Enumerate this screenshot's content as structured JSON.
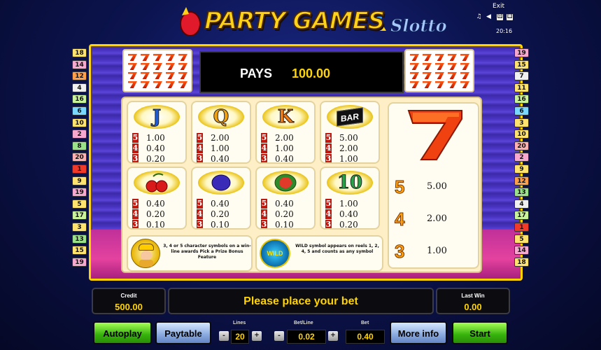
{
  "logo": {
    "title": "PARTY GAMES",
    "subtitle": "Slotto"
  },
  "system": {
    "exit_label": "Exit",
    "time": "20:16"
  },
  "paylines_left": [
    {
      "n": "18",
      "color": "#ffe36e"
    },
    {
      "n": "14",
      "color": "#f6a8cf"
    },
    {
      "n": "12",
      "color": "#ff9f4a"
    },
    {
      "n": "4",
      "color": "#f0f0f0"
    },
    {
      "n": "16",
      "color": "#c9f39a"
    },
    {
      "n": "6",
      "color": "#7ad7ff"
    },
    {
      "n": "10",
      "color": "#ffe36e"
    },
    {
      "n": "2",
      "color": "#f6a8cf"
    },
    {
      "n": "8",
      "color": "#9be18a"
    },
    {
      "n": "20",
      "color": "#ffb0b0"
    },
    {
      "n": "1",
      "color": "#f03a2a"
    },
    {
      "n": "9",
      "color": "#ffe36e"
    },
    {
      "n": "19",
      "color": "#f6a8cf"
    },
    {
      "n": "5",
      "color": "#ffe36e"
    },
    {
      "n": "17",
      "color": "#c9f39a"
    },
    {
      "n": "3",
      "color": "#ffe36e"
    },
    {
      "n": "13",
      "color": "#9be18a"
    },
    {
      "n": "15",
      "color": "#ffe36e"
    },
    {
      "n": "19",
      "color": "#f6a8cf"
    }
  ],
  "paylines_right": [
    {
      "n": "19",
      "color": "#f6a8cf"
    },
    {
      "n": "15",
      "color": "#ffe36e"
    },
    {
      "n": "7",
      "color": "#f0f0f0"
    },
    {
      "n": "11",
      "color": "#ffe36e"
    },
    {
      "n": "16",
      "color": "#c9f39a"
    },
    {
      "n": "6",
      "color": "#7ad7ff"
    },
    {
      "n": "3",
      "color": "#ffe36e"
    },
    {
      "n": "10",
      "color": "#ffe36e"
    },
    {
      "n": "20",
      "color": "#ffb0b0"
    },
    {
      "n": "2",
      "color": "#f6a8cf"
    },
    {
      "n": "9",
      "color": "#ffe36e"
    },
    {
      "n": "12",
      "color": "#ff9f4a"
    },
    {
      "n": "13",
      "color": "#9be18a"
    },
    {
      "n": "4",
      "color": "#f0f0f0"
    },
    {
      "n": "17",
      "color": "#c9f39a"
    },
    {
      "n": "1",
      "color": "#f03a2a"
    },
    {
      "n": "5",
      "color": "#ffe36e"
    },
    {
      "n": "14",
      "color": "#f6a8cf"
    },
    {
      "n": "18",
      "color": "#ffe36e"
    }
  ],
  "pays": {
    "label": "PAYS",
    "value": "100.00"
  },
  "symbols": [
    {
      "name": "J",
      "glyph": "J",
      "color": "#1a5de0",
      "pays": [
        {
          "n": "5",
          "v": "1.00"
        },
        {
          "n": "4",
          "v": "0.40"
        },
        {
          "n": "3",
          "v": "0.20"
        }
      ]
    },
    {
      "name": "Q",
      "glyph": "Q",
      "color": "#f2a10d",
      "pays": [
        {
          "n": "5",
          "v": "2.00"
        },
        {
          "n": "4",
          "v": "1.00"
        },
        {
          "n": "3",
          "v": "0.40"
        }
      ]
    },
    {
      "name": "K",
      "glyph": "K",
      "color": "#f07a14",
      "pays": [
        {
          "n": "5",
          "v": "2.00"
        },
        {
          "n": "4",
          "v": "1.00"
        },
        {
          "n": "3",
          "v": "0.40"
        }
      ]
    },
    {
      "name": "BAR",
      "glyph": "BAR",
      "color": "#ffffff",
      "pays": [
        {
          "n": "5",
          "v": "5.00"
        },
        {
          "n": "4",
          "v": "2.00"
        },
        {
          "n": "3",
          "v": "1.00"
        }
      ]
    },
    {
      "name": "cherries",
      "glyph": "",
      "color": "#d81a1a",
      "pays": [
        {
          "n": "5",
          "v": "0.40"
        },
        {
          "n": "4",
          "v": "0.20"
        },
        {
          "n": "3",
          "v": "0.10"
        }
      ]
    },
    {
      "name": "plum",
      "glyph": "",
      "color": "#3a2ab8",
      "pays": [
        {
          "n": "5",
          "v": "0.40"
        },
        {
          "n": "4",
          "v": "0.20"
        },
        {
          "n": "3",
          "v": "0.10"
        }
      ]
    },
    {
      "name": "watermelon",
      "glyph": "",
      "color": "#2f8a2a",
      "pays": [
        {
          "n": "5",
          "v": "0.40"
        },
        {
          "n": "4",
          "v": "0.20"
        },
        {
          "n": "3",
          "v": "0.10"
        }
      ]
    },
    {
      "name": "10",
      "glyph": "10",
      "color": "#2aa24a",
      "pays": [
        {
          "n": "5",
          "v": "1.00"
        },
        {
          "n": "4",
          "v": "0.40"
        },
        {
          "n": "3",
          "v": "0.20"
        }
      ]
    }
  ],
  "seven": {
    "glyph": "7",
    "pays": [
      {
        "n": "5",
        "v": "5.00"
      },
      {
        "n": "4",
        "v": "2.00"
      },
      {
        "n": "3",
        "v": "1.00"
      }
    ]
  },
  "bonus_text": "3, 4 or 5 character symbols on a win-line awards Pick a Prize Bonus Feature",
  "wild": {
    "label": "WILD",
    "text": "WILD symbol appears on reels 1, 2, 4, 5 and counts as any symbol"
  },
  "credit": {
    "label": "Credit",
    "value": "500.00"
  },
  "message": "Please place your bet",
  "last_win": {
    "label": "Last Win",
    "value": "0.00"
  },
  "controls": {
    "autoplay": "Autoplay",
    "paytable": "Paytable",
    "lines_label": "Lines",
    "lines_value": "20",
    "betline_label": "Bet/Line",
    "betline_value": "0.02",
    "bet_label": "Bet",
    "bet_value": "0.40",
    "more_info": "More info",
    "start": "Start",
    "minus": "-",
    "plus": "+"
  }
}
